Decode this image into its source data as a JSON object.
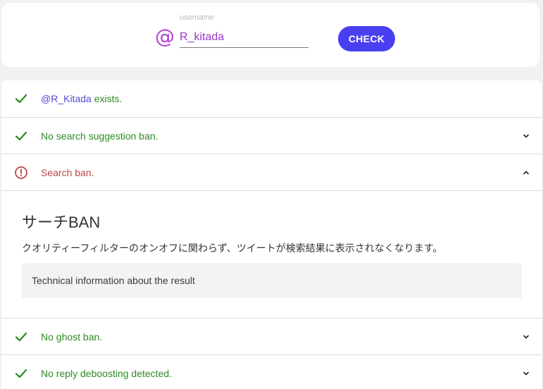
{
  "search": {
    "label": "username",
    "at_symbol": "@",
    "value": "R_kitada",
    "button_label": "CHECK"
  },
  "colors": {
    "accent": "#4a3ff0",
    "at_symbol": "#b23ad7",
    "ok": "#2c8a22",
    "error": "#b84848",
    "link": "#5548d1"
  },
  "results": {
    "exists": {
      "icon": "check-icon",
      "user": "@R_Kitada",
      "text": " exists."
    },
    "suggestion": {
      "icon": "check-icon",
      "text": "No search suggestion ban.",
      "chevron": "chevron-down-icon"
    },
    "search_ban": {
      "icon": "alert-circle-icon",
      "text": "Search ban.",
      "chevron": "chevron-up-icon",
      "detail": {
        "title": "サーチBAN",
        "description": "クオリティーフィルターのオンオフに関わらず、ツイートが検索結果に表示されなくなります。",
        "technical_label": "Technical information about the result"
      }
    },
    "ghost": {
      "icon": "check-icon",
      "text": "No ghost ban.",
      "chevron": "chevron-down-icon"
    },
    "reply": {
      "icon": "check-icon",
      "text": "No reply deboosting detected.",
      "chevron": "chevron-down-icon"
    }
  }
}
